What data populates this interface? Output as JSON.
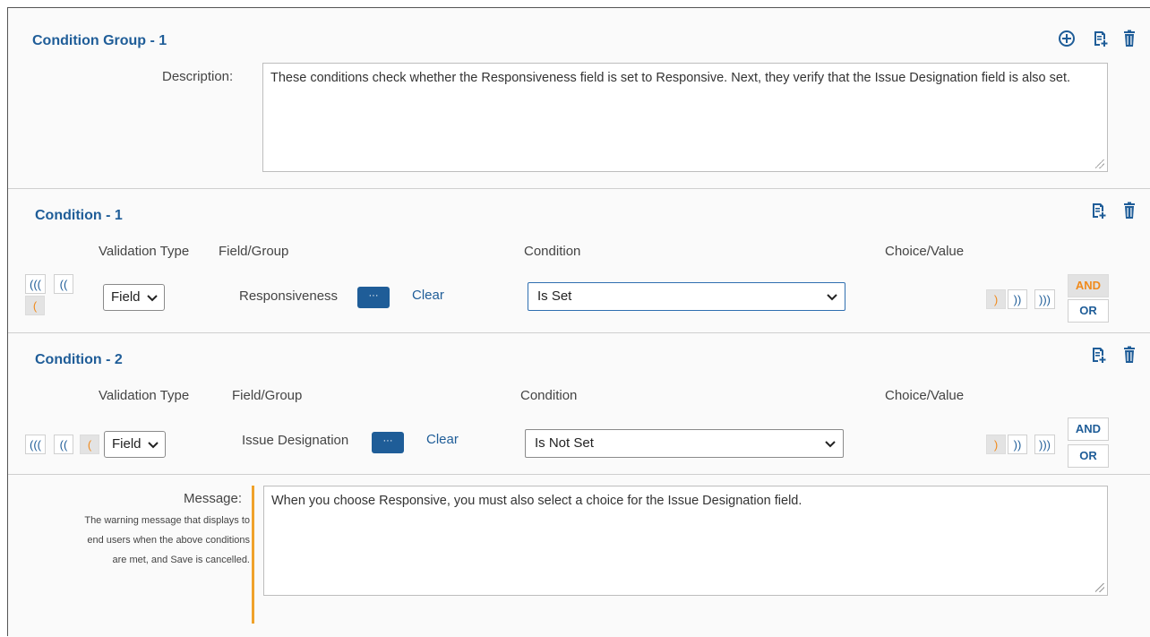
{
  "group": {
    "title": "Condition Group - 1",
    "description_label": "Description:",
    "description_value": "These conditions check whether the Responsiveness field is set to Responsive. Next, they verify that the Issue Designation field is also set."
  },
  "headers": {
    "validation_type": "Validation Type",
    "field_group": "Field/Group",
    "condition": "Condition",
    "choice_value": "Choice/Value"
  },
  "parens": {
    "open3": "(((",
    "open2": "((",
    "open1": "(",
    "close1": ")",
    "close2": "))",
    "close3": ")))"
  },
  "conditions": [
    {
      "title": "Condition - 1",
      "validation_type": "Field",
      "field": "Responsiveness",
      "dots": "···",
      "clear": "Clear",
      "condition": "Is Set",
      "and": "AND",
      "or": "OR"
    },
    {
      "title": "Condition - 2",
      "validation_type": "Field",
      "field": "Issue Designation",
      "dots": "···",
      "clear": "Clear",
      "condition": "Is Not Set",
      "and": "AND",
      "or": "OR"
    }
  ],
  "message": {
    "label": "Message:",
    "hint": [
      "The warning message that displays to",
      "end users when the above conditions",
      "are met, and Save is cancelled."
    ],
    "value": "When you choose Responsive, you must also select a choice for the Issue Designation field."
  },
  "colors": {
    "title_blue": "#1f5d98",
    "accent_orange": "#f08a1c",
    "bar_orange": "#f0a22a"
  },
  "icons": [
    "add-circle-icon",
    "copy-icon",
    "trash-icon"
  ]
}
